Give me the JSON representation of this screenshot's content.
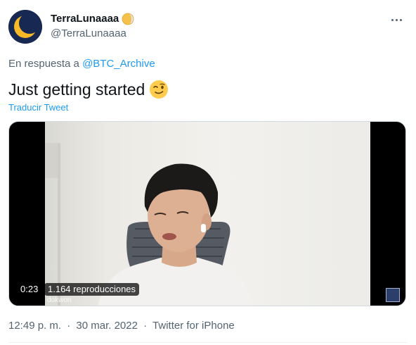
{
  "author": {
    "display_name": "TerraLunaaaa",
    "handle": "@TerraLunaaaa",
    "avatar_icon": "terra-luna-logo-icon",
    "name_badge_icon": "moon-icon"
  },
  "reply": {
    "prefix": "En respuesta a",
    "mention": "@BTC_Archive"
  },
  "tweet": {
    "text": "Just getting started",
    "emoji": "winking-face-icon",
    "translate_label": "Traducir Tweet"
  },
  "video": {
    "time": "0:23",
    "views": "1.164 reproducciones",
    "participant_name": "dokwon"
  },
  "meta": {
    "time": "12:49 p. m.",
    "separator": "·",
    "date": "30 mar. 2022",
    "source": "Twitter for iPhone"
  },
  "colors": {
    "link": "#1d9bf0",
    "secondary_text": "#536471",
    "primary_text": "#0f1419"
  }
}
